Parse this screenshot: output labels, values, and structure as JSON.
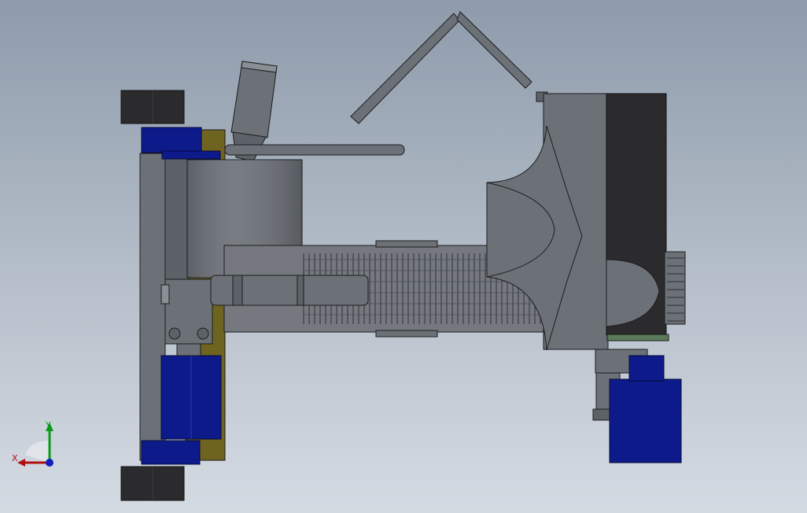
{
  "colors": {
    "steel_dark": "#555a60",
    "steel_mid": "#6c7178",
    "steel_light": "#8a8f95",
    "rubber": "#2b2b2d",
    "motor_blue": "#0d1a8a",
    "plate_olive": "#6e6420",
    "screw_grey": "#75797f",
    "outline": "#1c1c1c",
    "axis_x": "#b01010",
    "axis_y": "#0a9a1a",
    "axis_z": "#1020c0"
  },
  "triad": {
    "x_label": "X",
    "y_label": "Y"
  }
}
